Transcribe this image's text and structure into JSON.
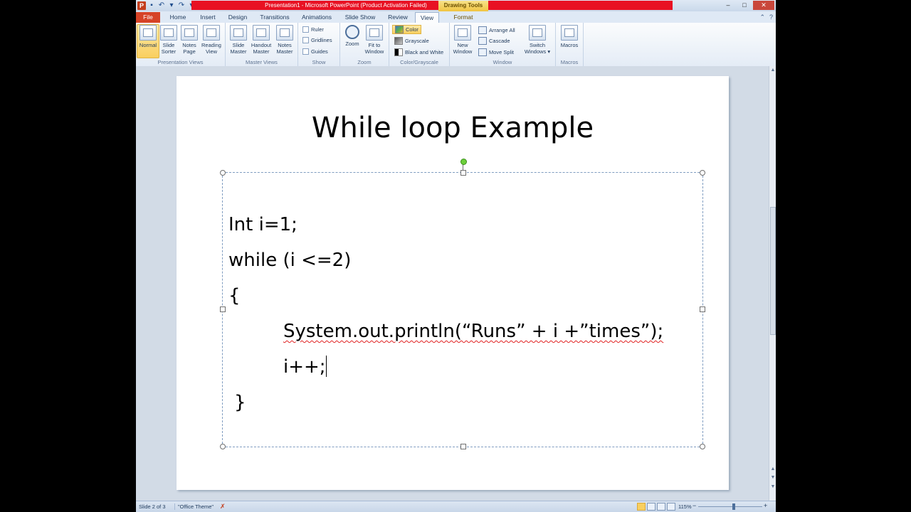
{
  "window": {
    "title": "Presentation1 - Microsoft PowerPoint (Product Activation Failed)",
    "context_tab": "Drawing Tools",
    "app_icon": "P"
  },
  "tabs": [
    "File",
    "Home",
    "Insert",
    "Design",
    "Transitions",
    "Animations",
    "Slide Show",
    "Review",
    "View",
    "Format"
  ],
  "active_tab": "View",
  "ribbon": {
    "presentation_views": {
      "label": "Presentation Views",
      "buttons": [
        "Normal",
        "Slide\nSorter",
        "Notes\nPage",
        "Reading\nView"
      ]
    },
    "master_views": {
      "label": "Master Views",
      "buttons": [
        "Slide\nMaster",
        "Handout\nMaster",
        "Notes\nMaster"
      ]
    },
    "show": {
      "label": "Show",
      "items": [
        "Ruler",
        "Gridlines",
        "Guides"
      ]
    },
    "zoom": {
      "label": "Zoom",
      "buttons": [
        "Zoom",
        "Fit to\nWindow"
      ]
    },
    "color_grayscale": {
      "label": "Color/Grayscale",
      "items": [
        "Color",
        "Grayscale",
        "Black and White"
      ]
    },
    "window": {
      "label": "Window",
      "new_window": "New\nWindow",
      "items": [
        "Arrange All",
        "Cascade",
        "Move Split"
      ],
      "switch": "Switch\nWindows ▾"
    },
    "macros": {
      "label": "Macros",
      "button": "Macros"
    }
  },
  "slide": {
    "title": "While loop Example",
    "lines": [
      "Int i=1;",
      "while (i <=2)",
      "{",
      "System.out.println(“Runs” + i +”times”);",
      "i++;",
      "}"
    ]
  },
  "status": {
    "slide_of": "Slide 2 of 3",
    "theme": "\"Office Theme\"",
    "zoom": "115%"
  },
  "colors": {
    "file_tab": "#d64327",
    "title_bar_warning": "#e81123",
    "accent": "#f9cf5f"
  }
}
